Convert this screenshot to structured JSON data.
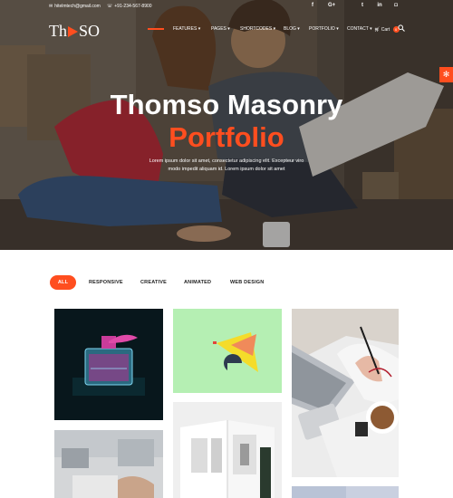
{
  "topbar": {
    "email": "hitelmtech@gmail.com",
    "phone": "+91-234-567-8900",
    "social_icons": [
      "facebook-icon",
      "google-plus-icon",
      "twitter-icon",
      "linkedin-icon",
      "instagram-icon"
    ],
    "social_glyphs": [
      "f",
      "G+",
      "t",
      "in",
      "◘"
    ]
  },
  "logo": {
    "part1": "Th",
    "part2": "SO"
  },
  "nav": {
    "items": [
      "FEATURES",
      "PAGES",
      "SHORTCODES",
      "BLOG",
      "PORTFOLIO",
      "CONTACT"
    ],
    "cart_label": "Cart",
    "cart_count": "0"
  },
  "hero": {
    "title": "Thomso Masonry",
    "subtitle": "Portfolio",
    "description_line1": "Lorem ipsum dolor sit amet, consectetur adipiscing elit. Excepteur viro",
    "description_line2": "modo impedit aliquam id. Lorem ipsum dolor sit amet"
  },
  "filters": [
    "ALL",
    "RESPONSIVE",
    "CREATIVE",
    "ANIMATED",
    "WEB DESIGN"
  ],
  "active_filter": "ALL",
  "colors": {
    "accent": "#ff4e1f",
    "text": "#222222"
  }
}
